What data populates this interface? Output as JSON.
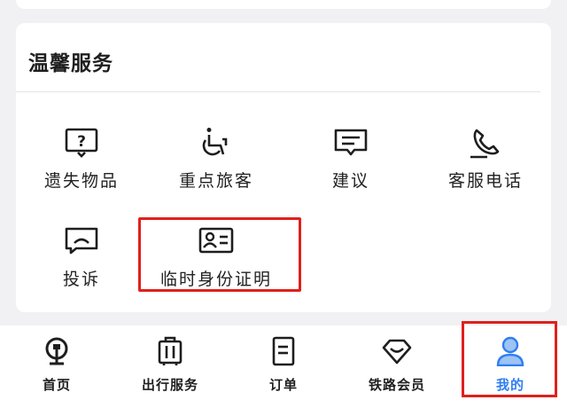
{
  "section": {
    "title": "温馨服务",
    "items": [
      {
        "label": "遗失物品",
        "icon": "question-box-icon"
      },
      {
        "label": "重点旅客",
        "icon": "wheelchair-icon"
      },
      {
        "label": "建议",
        "icon": "suggestion-chat-icon"
      },
      {
        "label": "客服电话",
        "icon": "phone-icon"
      },
      {
        "label": "投诉",
        "icon": "complaint-chat-icon"
      },
      {
        "label": "临时身份证明",
        "icon": "id-card-icon"
      }
    ]
  },
  "tabbar": {
    "items": [
      {
        "label": "首页",
        "icon": "railway-logo-icon"
      },
      {
        "label": "出行服务",
        "icon": "luggage-icon"
      },
      {
        "label": "订单",
        "icon": "order-doc-icon"
      },
      {
        "label": "铁路会员",
        "icon": "diamond-icon"
      },
      {
        "label": "我的",
        "icon": "user-icon",
        "active": true
      }
    ]
  },
  "colors": {
    "accent": "#2f7ef0",
    "highlight": "#e0201c",
    "background": "#f1f1f3"
  }
}
